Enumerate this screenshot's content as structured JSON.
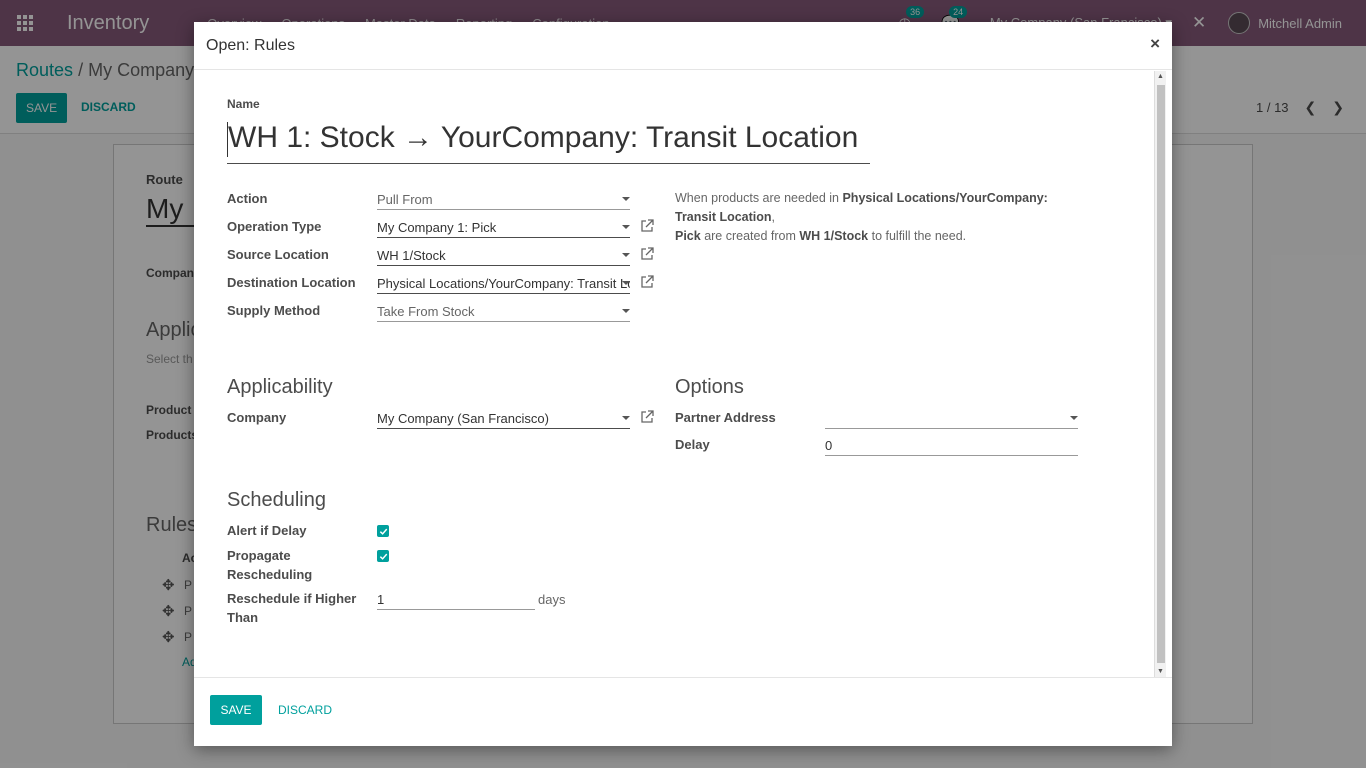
{
  "navbar": {
    "app_title": "Inventory",
    "menu": [
      "Overview",
      "Operations",
      "Master Data",
      "Reporting",
      "Configuration"
    ],
    "activity_count": "36",
    "message_count": "24",
    "company": "My Company (San Francisco)",
    "user": "Mitchell Admin"
  },
  "control": {
    "breadcrumb_root": "Routes",
    "breadcrumb_sep": "/",
    "breadcrumb_current": "My Company",
    "save_label": "SAVE",
    "discard_label": "DISCARD",
    "pager": "1 / 13"
  },
  "background_form": {
    "route_label": "Route",
    "route_name": "My",
    "company_label": "Compan",
    "applicable_title": "Applic",
    "applicable_hint": "Select th",
    "product_label": "Product",
    "products_label": "Products",
    "rules_title": "Rules",
    "rules_col": "Ac",
    "row_prefix": "P",
    "add_line": "Ad"
  },
  "modal": {
    "title": "Open: Rules",
    "close": "×",
    "name_label": "Name",
    "name_value": "WH 1: Stock → YourCompany: Transit Location",
    "fields": {
      "action_label": "Action",
      "action_value": "Pull From",
      "operation_type_label": "Operation Type",
      "operation_type_value": "My Company 1: Pick",
      "source_location_label": "Source Location",
      "source_location_value": "WH 1/Stock",
      "destination_location_label": "Destination Location",
      "destination_location_value": "Physical Locations/YourCompany: Transit Location",
      "supply_method_label": "Supply Method",
      "supply_method_value": "Take From Stock"
    },
    "help": {
      "p1": "When products are needed in ",
      "p1_bold": "Physical Locations/YourCompany: Transit Location",
      "p1_end": ",",
      "p2_bold": "Pick",
      "p2": " are created from ",
      "p2_bold2": "WH 1/Stock",
      "p2_end": " to fulfill the need."
    },
    "applicability": {
      "title": "Applicability",
      "company_label": "Company",
      "company_value": "My Company (San Francisco)"
    },
    "options": {
      "title": "Options",
      "partner_address_label": "Partner Address",
      "partner_address_value": "",
      "delay_label": "Delay",
      "delay_value": "0"
    },
    "scheduling": {
      "title": "Scheduling",
      "alert_label": "Alert if Delay",
      "alert_checked": true,
      "propagate_label_1": "Propagate",
      "propagate_label_2": "Rescheduling",
      "propagate_checked": true,
      "reschedule_label_1": "Reschedule if Higher",
      "reschedule_label_2": "Than",
      "reschedule_value": "1",
      "reschedule_suffix": "days"
    },
    "footer": {
      "save_label": "SAVE",
      "discard_label": "DISCARD"
    }
  },
  "colors": {
    "navbar": "#875a7b",
    "accent": "#00a09d"
  }
}
